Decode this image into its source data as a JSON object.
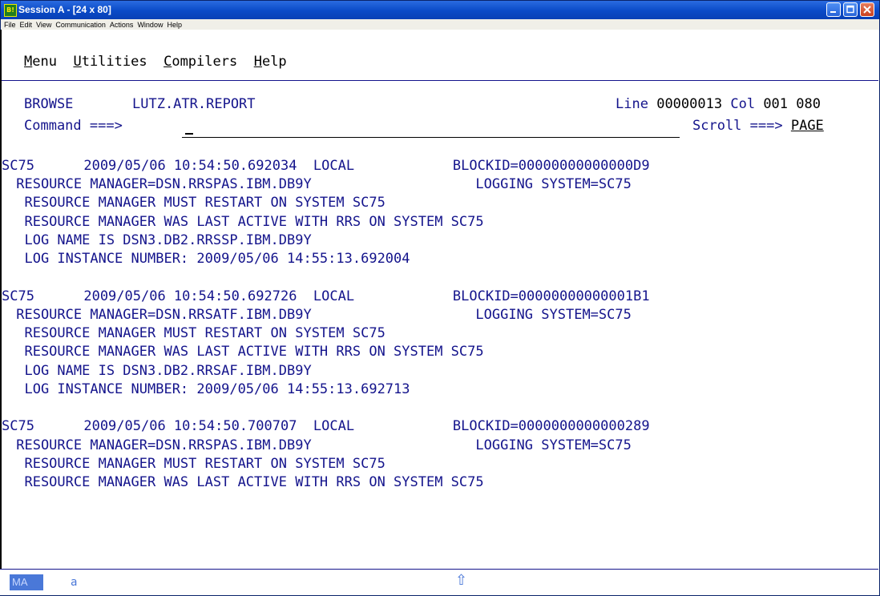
{
  "window": {
    "title": "Session A - [24 x 80]",
    "icon_text": "B!"
  },
  "menubar": {
    "items": [
      "File",
      "Edit",
      "View",
      "Communication",
      "Actions",
      "Window",
      "Help"
    ]
  },
  "pulldown": {
    "items": [
      {
        "hot": "M",
        "rest": "enu"
      },
      {
        "hot": "U",
        "rest": "tilities"
      },
      {
        "hot": "C",
        "rest": "ompilers"
      },
      {
        "hot": "H",
        "rest": "elp"
      }
    ]
  },
  "browse": {
    "mode": "BROWSE",
    "dataset": "LUTZ.ATR.REPORT",
    "line_label": "Line",
    "line_value": "00000013",
    "col_label": "Col",
    "col_value": "001 080",
    "command_label": "Command ===>",
    "scroll_label": "Scroll ===>",
    "scroll_value": "PAGE"
  },
  "records": [
    {
      "header": "SC75      2009/05/06 10:54:50.692034  LOCAL            BLOCKID=00000000000000D9",
      "lines": [
        " RESOURCE MANAGER=DSN.RRSPAS.IBM.DB9Y                    LOGGING SYSTEM=SC75",
        "  RESOURCE MANAGER MUST RESTART ON SYSTEM SC75",
        "  RESOURCE MANAGER WAS LAST ACTIVE WITH RRS ON SYSTEM SC75",
        "  LOG NAME IS DSN3.DB2.RRSSP.IBM.DB9Y",
        "  LOG INSTANCE NUMBER: 2009/05/06 14:55:13.692004"
      ]
    },
    {
      "header": "SC75      2009/05/06 10:54:50.692726  LOCAL            BLOCKID=00000000000001B1",
      "lines": [
        " RESOURCE MANAGER=DSN.RRSATF.IBM.DB9Y                    LOGGING SYSTEM=SC75",
        "  RESOURCE MANAGER MUST RESTART ON SYSTEM SC75",
        "  RESOURCE MANAGER WAS LAST ACTIVE WITH RRS ON SYSTEM SC75",
        "  LOG NAME IS DSN3.DB2.RRSAF.IBM.DB9Y",
        "  LOG INSTANCE NUMBER: 2009/05/06 14:55:13.692713"
      ]
    },
    {
      "header": "SC75      2009/05/06 10:54:50.700707  LOCAL            BLOCKID=0000000000000289",
      "lines": [
        " RESOURCE MANAGER=DSN.RRSPAS.IBM.DB9Y                    LOGGING SYSTEM=SC75",
        "  RESOURCE MANAGER MUST RESTART ON SYSTEM SC75",
        "  RESOURCE MANAGER WAS LAST ACTIVE WITH RRS ON SYSTEM SC75"
      ]
    }
  ],
  "status": {
    "mode_indicator": "MA",
    "session_letter": "a",
    "shift_arrow": "⇧"
  },
  "colors": {
    "screen_text": "#14148c",
    "titlebar": "#0a4ac7",
    "oia_accent": "#4a78d8"
  }
}
